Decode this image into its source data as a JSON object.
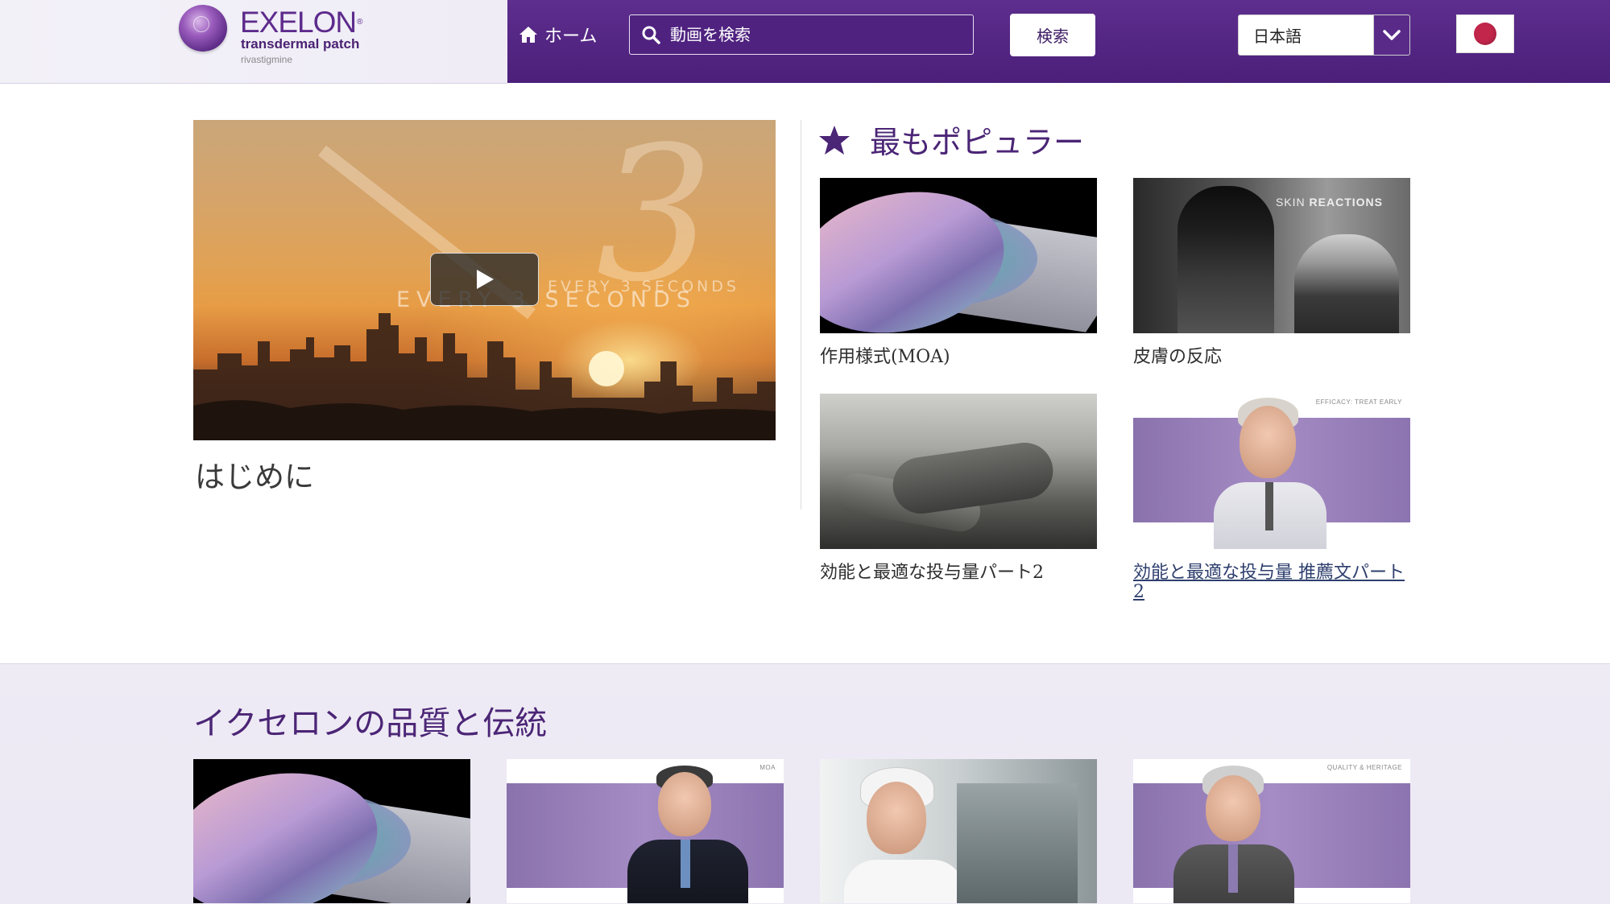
{
  "header": {
    "logo": {
      "brand": "EXELON",
      "registered": "®",
      "subtitle": "transdermal patch",
      "generic": "rivastigmine"
    },
    "home_label": "ホーム",
    "search_placeholder": "動画を検索",
    "search_button": "検索",
    "language": "日本語",
    "icons": {
      "home": "home-icon",
      "search": "search-icon",
      "caret": "chevron-down-icon",
      "flag": "japan-flag-icon"
    }
  },
  "featured": {
    "title": "はじめに",
    "overlay_text": "EVERY 3 SECONDS",
    "overlay_digit": "3",
    "play_icon": "play-icon"
  },
  "popular": {
    "heading": "最もポピュラー",
    "icon": "star-icon",
    "items": [
      {
        "label": "作用様式(MOA)"
      },
      {
        "label": "皮膚の反応",
        "thumb_caption_light": "SKIN ",
        "thumb_caption_bold": "REACTIONS"
      },
      {
        "label": "効能と最適な投与量パート2"
      },
      {
        "label": "効能と最適な投与量 推薦文パート2",
        "thumb_caption": "EFFICACY: TREAT EARLY"
      }
    ]
  },
  "quality": {
    "heading": "イクセロンの品質と伝統",
    "items": [
      {
        "caption": ""
      },
      {
        "caption": "MOA"
      },
      {
        "caption": ""
      },
      {
        "caption": "QUALITY & HERITAGE"
      }
    ]
  },
  "colors": {
    "brand_purple": "#5e2e8e",
    "heading_purple": "#4b2576",
    "link_blue": "#2e3f6e"
  }
}
